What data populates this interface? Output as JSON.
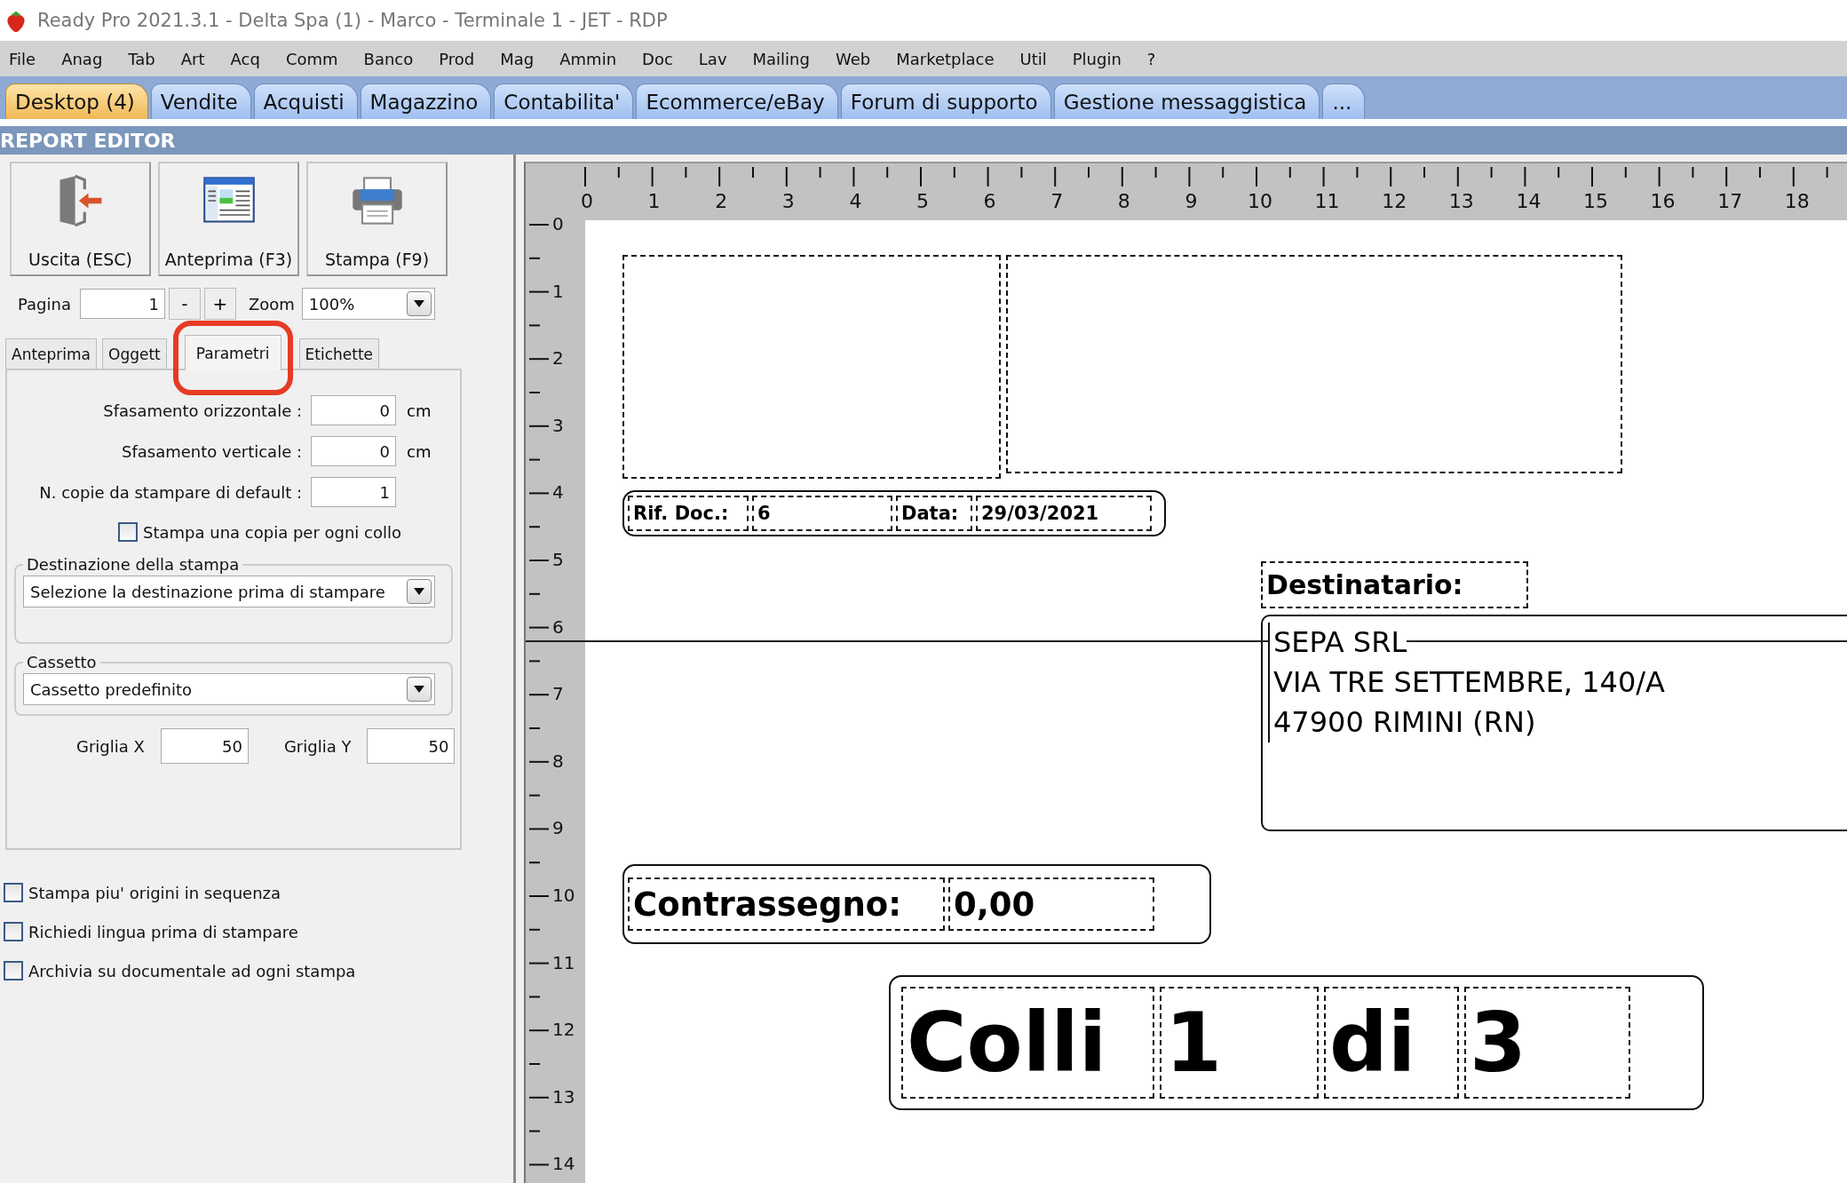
{
  "window": {
    "title": "Ready Pro 2021.3.1 - Delta Spa (1) - Marco - Terminale 1 - JET - RDP"
  },
  "menu": [
    "File",
    "Anag",
    "Tab",
    "Art",
    "Acq",
    "Comm",
    "Banco",
    "Prod",
    "Mag",
    "Ammin",
    "Doc",
    "Lav",
    "Mailing",
    "Web",
    "Marketplace",
    "Util",
    "Plugin",
    "?"
  ],
  "tabs": [
    {
      "label": "Desktop (4)",
      "selected": true
    },
    {
      "label": "Vendite",
      "selected": false
    },
    {
      "label": "Acquisti",
      "selected": false
    },
    {
      "label": "Magazzino",
      "selected": false
    },
    {
      "label": "Contabilita'",
      "selected": false
    },
    {
      "label": "Ecommerce/eBay",
      "selected": false
    },
    {
      "label": "Forum di supporto",
      "selected": false
    },
    {
      "label": "Gestione messaggistica",
      "selected": false
    },
    {
      "label": "...",
      "selected": false
    }
  ],
  "section_title": "REPORT EDITOR",
  "toolbar": [
    {
      "label": "Uscita (ESC)",
      "kind": "exit"
    },
    {
      "label": "Anteprima (F3)",
      "kind": "preview"
    },
    {
      "label": "Stampa (F9)",
      "kind": "print"
    }
  ],
  "pager": {
    "label": "Pagina",
    "value": "1",
    "decrement": "-",
    "increment": "+",
    "zoom_label": "Zoom",
    "zoom_value": "100%"
  },
  "panel_tabs": [
    {
      "label": "Anteprima",
      "selected": false,
      "highlighted": false
    },
    {
      "label": "Oggett",
      "selected": false,
      "highlighted": false
    },
    {
      "label": "Parametri",
      "selected": true,
      "highlighted": true
    },
    {
      "label": "Etichette",
      "selected": false,
      "highlighted": false
    }
  ],
  "parameters": {
    "fields": [
      {
        "label": "Sfasamento orizzontale :",
        "value": "0",
        "unit": "cm"
      },
      {
        "label": "Sfasamento verticale :",
        "value": "0",
        "unit": "cm"
      },
      {
        "label": "N. copie da stampare di default :",
        "value": "1"
      }
    ],
    "copy_per_parcel": {
      "label": "Stampa una copia per ogni collo",
      "checked": false
    },
    "destination": {
      "legend": "Destinazione della stampa",
      "value": "Selezione la destinazione prima di stampare"
    },
    "tray": {
      "legend": "Cassetto",
      "value": "Cassetto predefinito"
    },
    "grid": {
      "x_label": "Griglia X",
      "x_value": "50",
      "y_label": "Griglia Y",
      "y_value": "50"
    }
  },
  "options": [
    {
      "label": "Stampa piu' origini in sequenza",
      "checked": false
    },
    {
      "label": "Richiedi lingua prima di stampare",
      "checked": false
    },
    {
      "label": "Archivia su documentale ad ogni stampa",
      "checked": false
    }
  ],
  "ruler": {
    "x_labels": [
      "0",
      "1",
      "2",
      "3",
      "4",
      "5",
      "6",
      "7",
      "8",
      "9",
      "10",
      "11",
      "12",
      "13",
      "14",
      "15",
      "16",
      "17",
      "18"
    ],
    "y_labels": [
      "0",
      "1",
      "2",
      "3",
      "4",
      "5",
      "6",
      "7",
      "8",
      "9",
      "10",
      "11",
      "12",
      "13",
      "14"
    ]
  },
  "report": {
    "doc_ref": {
      "label": "Rif. Doc.:",
      "value": "6"
    },
    "date": {
      "label": "Data:",
      "value": "29/03/2021"
    },
    "recipient": {
      "label": "Destinatario:",
      "lines": [
        "SEPA SRL",
        "VIA TRE SETTEMBRE, 140/A",
        "47900 RIMINI (RN)"
      ]
    },
    "cod": {
      "label": "Contrassegno:",
      "value": "0,00"
    },
    "parcels": [
      "Colli",
      "1",
      "di",
      "3"
    ]
  }
}
